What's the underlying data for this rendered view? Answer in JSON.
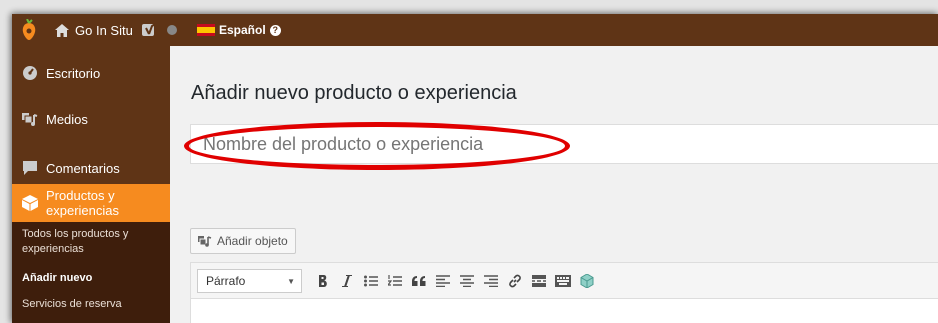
{
  "adminbar": {
    "site_name": "Go In Situ",
    "language": "Español",
    "help_glyph": "?"
  },
  "sidebar": {
    "items": [
      {
        "label": "Escritorio",
        "icon": "dashboard-icon"
      },
      {
        "label": "Medios",
        "icon": "media-icon"
      },
      {
        "label": "Comentarios",
        "icon": "comments-icon"
      },
      {
        "label_line1": "Productos y",
        "label_line2": "experiencias",
        "icon": "product-box-icon",
        "active": true
      }
    ],
    "submenu": [
      {
        "line1": "Todos los productos y",
        "line2": "experiencias"
      },
      {
        "line1": "Añadir nuevo",
        "current": true
      },
      {
        "line1": "Servicios de reserva"
      }
    ]
  },
  "main": {
    "page_title": "Añadir nuevo producto o experiencia",
    "title_placeholder": "Nombre del producto o experiencia",
    "add_media_label": "Añadir objeto",
    "format_select_value": "Párrafo"
  },
  "colors": {
    "adminbar": "#5f3416",
    "accent": "#f68b1f",
    "highlight_ellipse": "#e00000"
  }
}
